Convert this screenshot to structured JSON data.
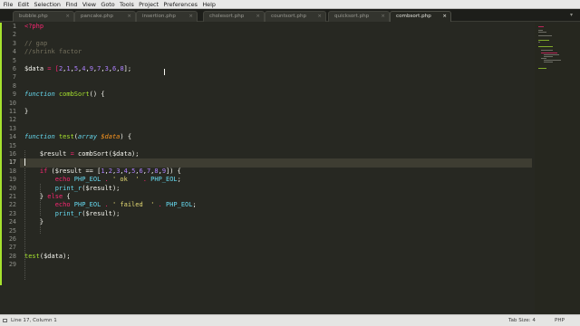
{
  "menu": [
    "File",
    "Edit",
    "Selection",
    "Find",
    "View",
    "Goto",
    "Tools",
    "Project",
    "Preferences",
    "Help"
  ],
  "tabs": [
    {
      "label": "bubble.php",
      "active": false
    },
    {
      "label": "pancake.php",
      "active": false
    },
    {
      "label": "insertion.php",
      "active": false
    },
    {
      "label": "cholesort.php",
      "active": false
    },
    {
      "label": "countsort.php",
      "active": false
    },
    {
      "label": "quicksort.php",
      "active": false
    },
    {
      "label": "combsort.php",
      "active": true
    }
  ],
  "tab_close_glyph": "×",
  "tab_scroll_glyph": "▾",
  "current_line": 17,
  "line_numbers": [
    "1",
    "2",
    "3",
    "4",
    "5",
    "6",
    "7",
    "8",
    "9",
    "10",
    "11",
    "12",
    "13",
    "14",
    "15",
    "16",
    "17",
    "18",
    "19",
    "20",
    "21",
    "22",
    "23",
    "24",
    "25",
    "26",
    "27",
    "28",
    "29"
  ],
  "code": {
    "l1_open": "<?php",
    "l3_comment": "// gap",
    "l4_comment": "//shrink factor",
    "l6_var": "$data",
    "l6_op": " = [",
    "l6_nums": [
      "2",
      "1",
      "5",
      "4",
      "9",
      "7",
      "3",
      "6",
      "8"
    ],
    "l6_end": "];",
    "kw_function": "function",
    "l9_name": "combSort",
    "l9_rest": "() {",
    "l11_brace": "}",
    "l14_name": "test",
    "l14_type": "array",
    "l14_param": "$data",
    "l14_rest": ") {",
    "l16_var": "$result",
    "l16_eq": " = ",
    "l16_call": "combSort",
    "l16_arg": "($data);",
    "kw_if": "if",
    "l18_mid": " ($result == [",
    "l18_nums": [
      "1",
      "2",
      "3",
      "4",
      "5",
      "6",
      "7",
      "8",
      "9"
    ],
    "l18_end": "]) {",
    "kw_echo": "echo",
    "const_eol": "PHP_EOL",
    "dot": " . ",
    "l19_str": "' ok  '",
    "l19_end": ";",
    "l20_fn": "print_r",
    "l20_arg": "($result);",
    "l21_close": "} ",
    "kw_else": "else",
    "l21_open": " {",
    "l22_str": "' failed  '",
    "l24_brace": "}",
    "l28_fn": "test",
    "l28_arg": "($data);"
  },
  "status": {
    "position": "Line 17, Column 1",
    "tab_size": "Tab Size: 4",
    "syntax": "PHP"
  },
  "colors": {
    "background": "#272822",
    "keyword": "#f92672",
    "function_name": "#a6e22e",
    "number": "#ae81ff",
    "string": "#e6db74",
    "comment": "#75715e",
    "parameter": "#fd971f",
    "storage": "#66d9ef"
  }
}
